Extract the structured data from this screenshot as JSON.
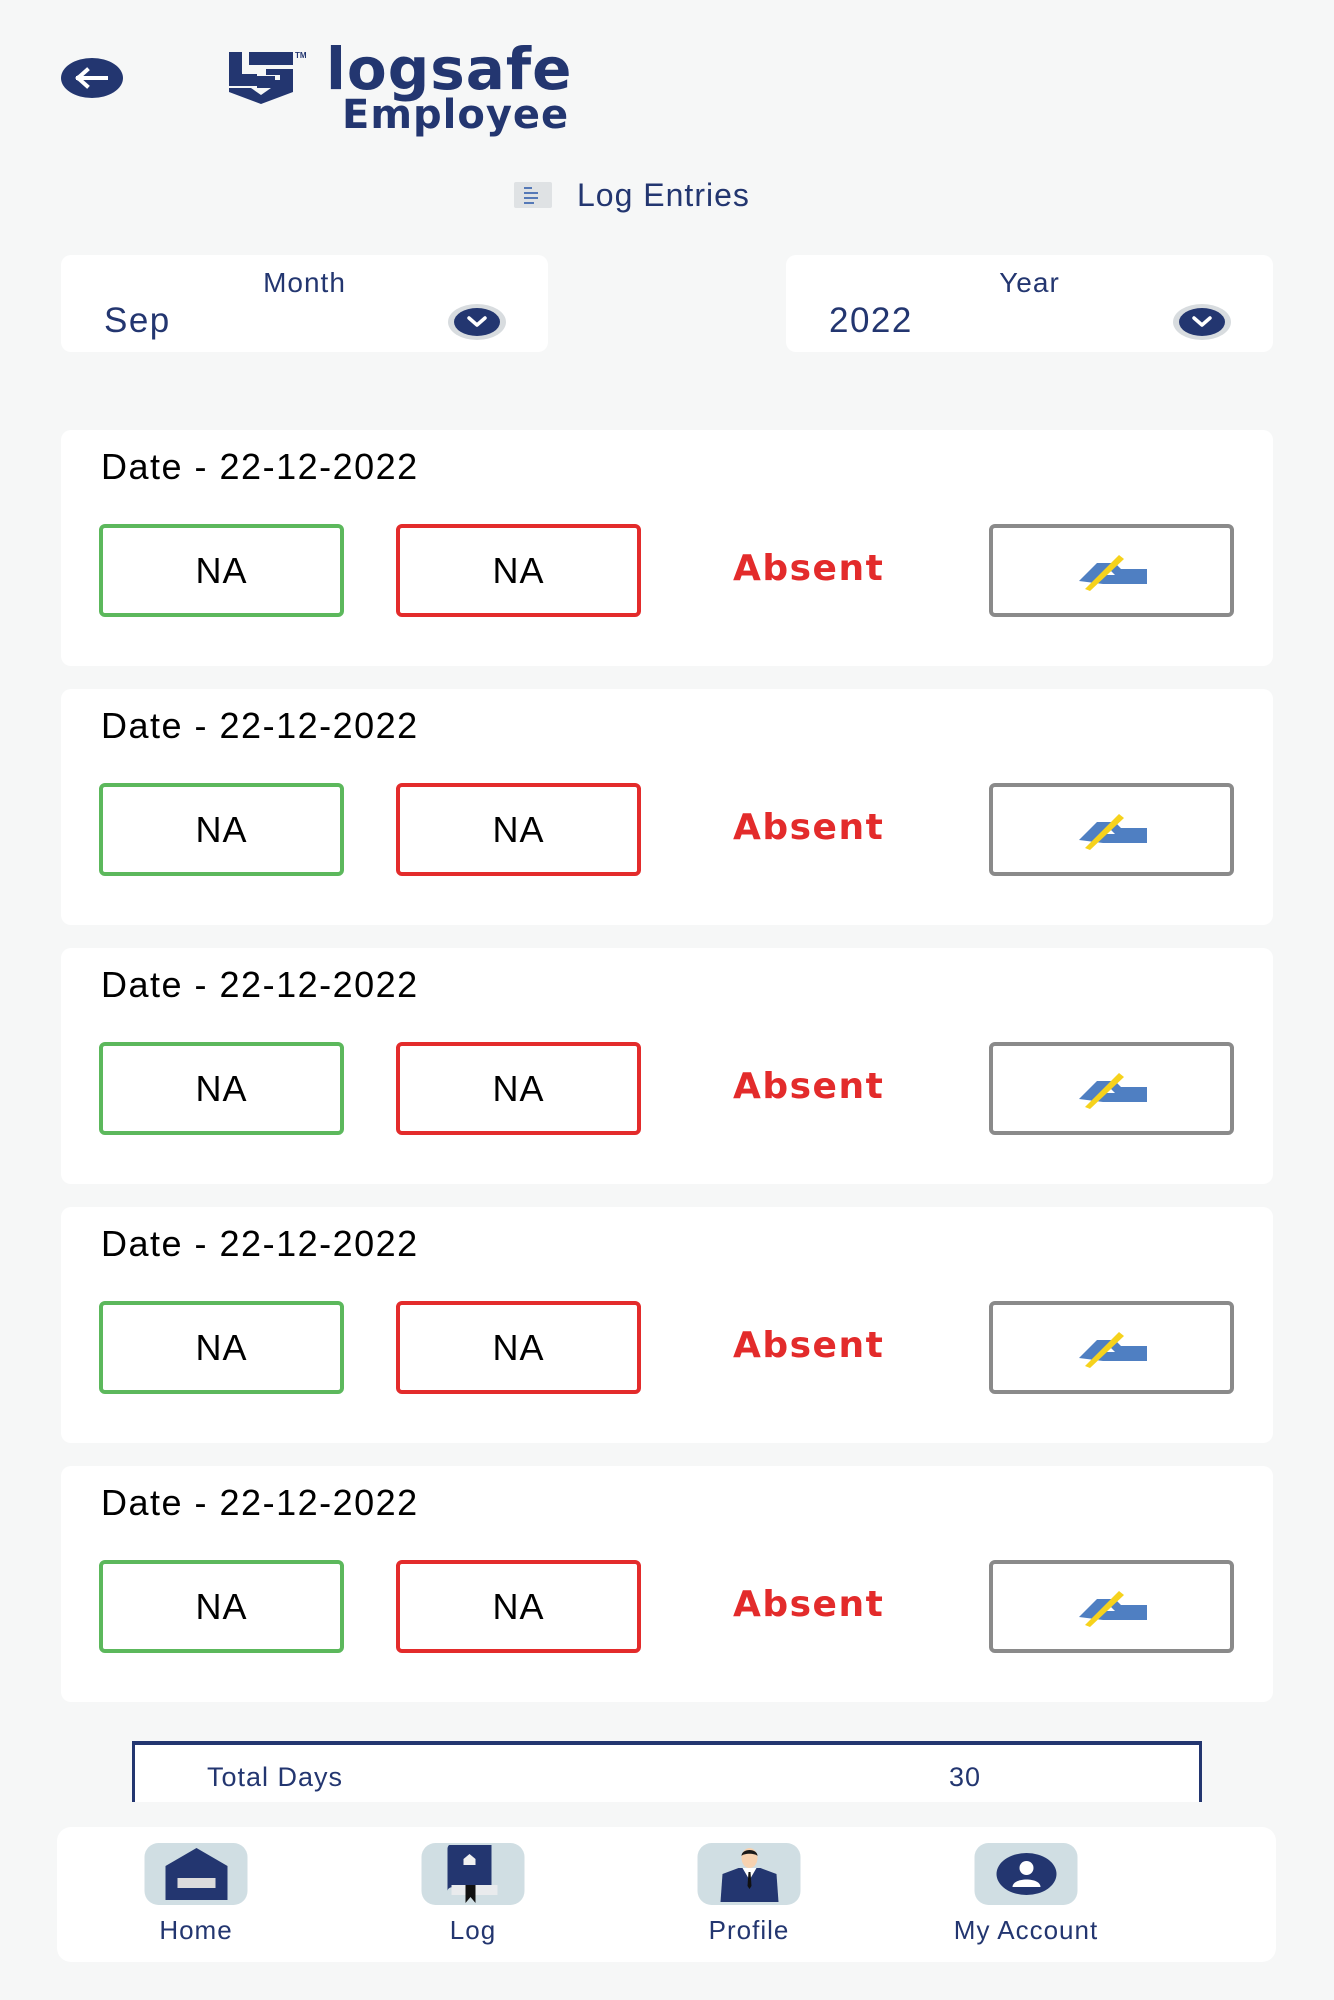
{
  "header": {
    "back_icon": "arrow-left-icon",
    "logo_word": "logsafe",
    "logo_tm": "TM",
    "logo_sub": "Employee"
  },
  "section": {
    "icon": "list-icon",
    "title": "Log Entries"
  },
  "filters": {
    "month": {
      "label": "Month",
      "value": "Sep",
      "icon": "chevron-down-icon"
    },
    "year": {
      "label": "Year",
      "value": "2022",
      "icon": "chevron-down-icon"
    }
  },
  "entries": [
    {
      "date": "Date - 22-12-2022",
      "in_time": "NA",
      "out_time": "NA",
      "status": "Absent",
      "sign_icon": "signature-hand-icon"
    },
    {
      "date": "Date - 22-12-2022",
      "in_time": "NA",
      "out_time": "NA",
      "status": "Absent",
      "sign_icon": "signature-hand-icon"
    },
    {
      "date": "Date - 22-12-2022",
      "in_time": "NA",
      "out_time": "NA",
      "status": "Absent",
      "sign_icon": "signature-hand-icon"
    },
    {
      "date": "Date - 22-12-2022",
      "in_time": "NA",
      "out_time": "NA",
      "status": "Absent",
      "sign_icon": "signature-hand-icon"
    },
    {
      "date": "Date - 22-12-2022",
      "in_time": "NA",
      "out_time": "NA",
      "status": "Absent",
      "sign_icon": "signature-hand-icon"
    }
  ],
  "totals": {
    "label": "Total Days",
    "value": "30"
  },
  "nav": [
    {
      "label": "Home",
      "icon": "home-icon"
    },
    {
      "label": "Log",
      "icon": "log-book-icon"
    },
    {
      "label": "Profile",
      "icon": "profile-person-icon"
    },
    {
      "label": "My Account",
      "icon": "account-circle-icon"
    }
  ],
  "colors": {
    "brand": "#233670",
    "in_border": "#5cb85c",
    "out_border": "#e32b2b",
    "status_absent": "#e32b2b",
    "sign_border": "#8a8a8a",
    "nav_tile": "#d0dee3",
    "background": "#f6f7f7"
  }
}
